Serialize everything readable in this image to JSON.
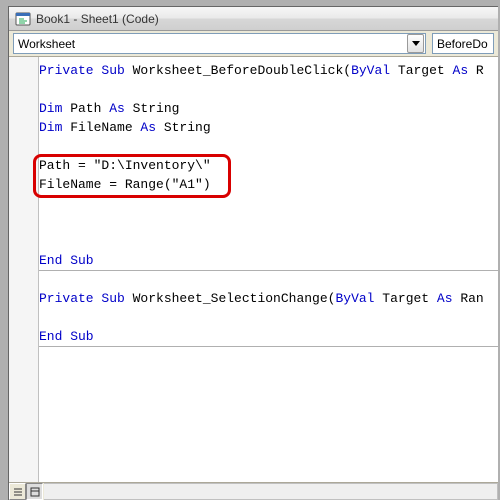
{
  "window": {
    "title": "Book1 - Sheet1 (Code)",
    "icon_label": "code-module-icon"
  },
  "dropdowns": {
    "object": {
      "value": "Worksheet"
    },
    "procedure": {
      "value": "BeforeDo"
    }
  },
  "highlight": {
    "path_line": "Path = \"D:\\Inventory\\\"",
    "filename_line": "FileName = Range(\"A1\")"
  },
  "code": {
    "l1a": "Private",
    "l1b": " Sub",
    "l1c": " Worksheet_BeforeDoubleClick(",
    "l1d": "ByVal",
    "l1e": " Target ",
    "l1f": "As",
    "l1g": " R",
    "l3a": "Dim",
    "l3b": " Path ",
    "l3c": "As",
    "l3d": " String",
    "l4a": "Dim",
    "l4b": " FileName ",
    "l4c": "As",
    "l4d": " String",
    "l8a": "End",
    "l8b": " Sub",
    "l10a": "Private",
    "l10b": " Sub",
    "l10c": " Worksheet_SelectionChange(",
    "l10d": "ByVal",
    "l10e": " Target ",
    "l10f": "As",
    "l10g": " Ran",
    "l12a": "End",
    "l12b": " Sub"
  }
}
